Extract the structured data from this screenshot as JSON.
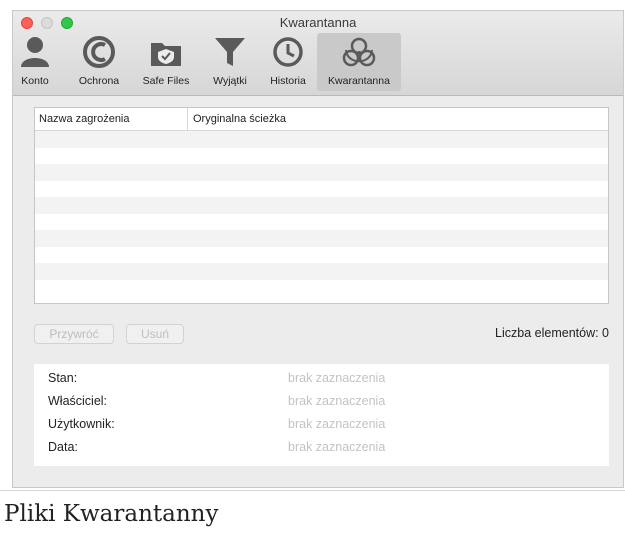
{
  "window": {
    "title": "Kwarantanna"
  },
  "toolbar": {
    "items": [
      {
        "label": "Konto",
        "icon": "person-icon"
      },
      {
        "label": "Ochrona",
        "icon": "protection-icon"
      },
      {
        "label": "Safe Files",
        "icon": "safe-files-icon"
      },
      {
        "label": "Wyjątki",
        "icon": "filter-icon"
      },
      {
        "label": "Historia",
        "icon": "clock-icon"
      },
      {
        "label": "Kwarantanna",
        "icon": "biohazard-icon",
        "active": true
      }
    ]
  },
  "table": {
    "columns": [
      "Nazwa zagrożenia",
      "Oryginalna ścieżka"
    ],
    "rows": []
  },
  "actions": {
    "restore_label": "Przywróć",
    "delete_label": "Usuń",
    "count_label": "Liczba elementów: 0"
  },
  "details": {
    "status_label": "Stan:",
    "status_value": "brak zaznaczenia",
    "owner_label": "Właściciel:",
    "owner_value": "brak zaznaczenia",
    "user_label": "Użytkownik:",
    "user_value": "brak zaznaczenia",
    "date_label": "Data:",
    "date_value": "brak zaznaczenia"
  },
  "caption": "Pliki Kwarantanny",
  "colors": {
    "close": "#fc5f57",
    "minimize": "#dcdcdc",
    "maximize": "#33c748",
    "icon_gray": "#5a5a5a"
  }
}
